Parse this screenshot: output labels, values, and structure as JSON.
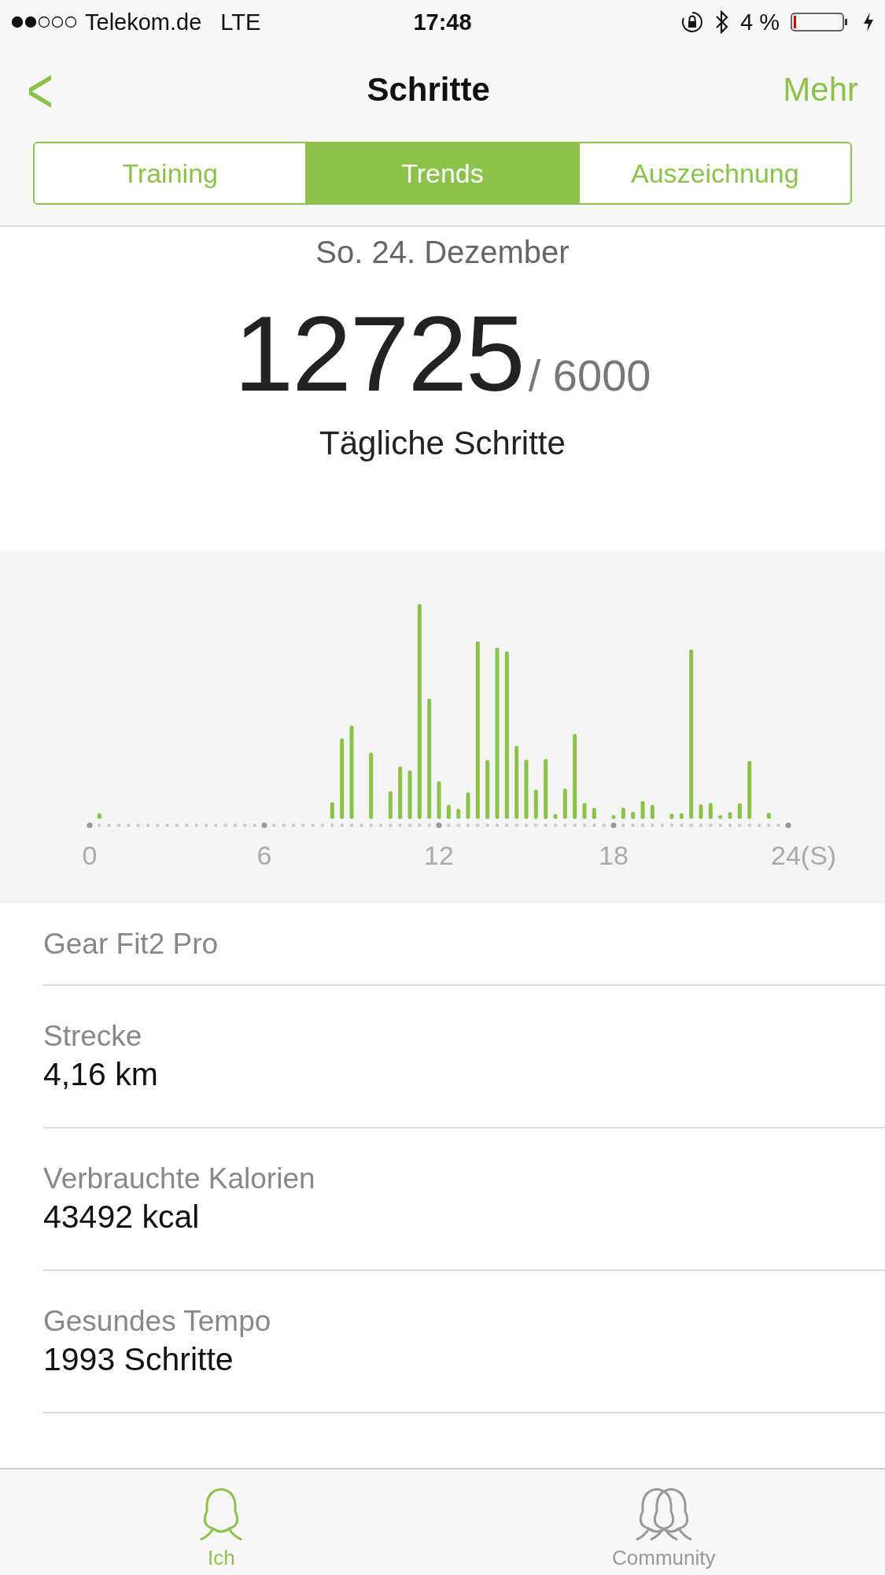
{
  "status_bar": {
    "carrier": "Telekom.de",
    "network": "LTE",
    "time": "17:48",
    "battery": "4 %"
  },
  "nav": {
    "back": "<",
    "title": "Schritte",
    "more": "Mehr"
  },
  "tabs": [
    {
      "label": "Training",
      "selected": false
    },
    {
      "label": "Trends",
      "selected": true
    },
    {
      "label": "Auszeichnung",
      "selected": false
    }
  ],
  "summary": {
    "date": "So. 24. Dezember",
    "steps": "12725",
    "goal": "/ 6000",
    "caption": "Tägliche Schritte"
  },
  "chart": {
    "x_labels": [
      "0",
      "6",
      "12",
      "18",
      "24(S)"
    ]
  },
  "device": "Gear Fit2 Pro",
  "stats": [
    {
      "label": "Strecke",
      "value": "4,16 km"
    },
    {
      "label": "Verbrauchte Kalorien",
      "value": "43492 kcal"
    },
    {
      "label": "Gesundes Tempo",
      "value": "1993 Schritte"
    }
  ],
  "tab_bar": [
    {
      "label": "Ich",
      "selected": true,
      "kind": "person"
    },
    {
      "label": "Community",
      "selected": false,
      "kind": "group"
    }
  ]
}
